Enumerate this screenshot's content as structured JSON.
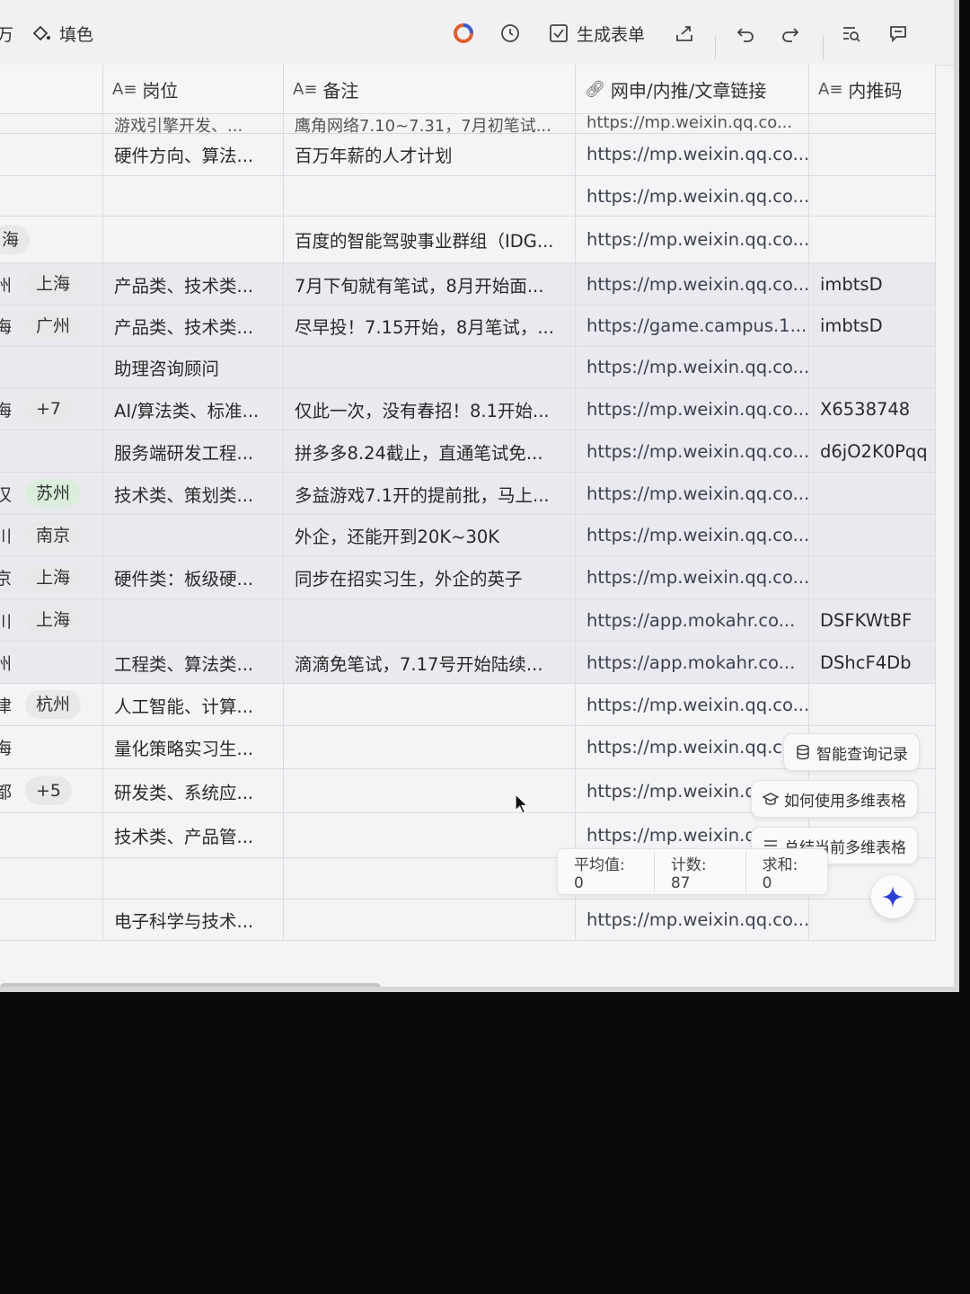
{
  "toolbar": {
    "fill_label": "填色",
    "form_label": "生成表单",
    "left_fragment": "万"
  },
  "columns": {
    "position": "岗位",
    "remark": "备注",
    "link": "网申/内推/文章链接",
    "code": "内推码"
  },
  "partial_row": {
    "position": "游戏引擎开发、...",
    "remark": "鹰角网络7.10~7.31，7月初笔试...",
    "link": "https://mp.weixin.qq.co..."
  },
  "rows": [
    {
      "frag": "",
      "tags": [],
      "position": "硬件方向、算法...",
      "remark": "百万年薪的人才计划",
      "link": "https://mp.weixin.qq.co...",
      "code": ""
    },
    {
      "frag": "",
      "tags": [],
      "position": "",
      "remark": "",
      "link": "https://mp.weixin.qq.co...",
      "code": ""
    },
    {
      "frag": "",
      "tags": [
        {
          "label": "海",
          "color": "plain"
        }
      ],
      "position": "",
      "remark": "百度的智能驾驶事业群组（IDG...",
      "link": "https://mp.weixin.qq.co...",
      "code": ""
    },
    {
      "frag": "州",
      "tags": [
        {
          "label": "上海",
          "color": "plain"
        }
      ],
      "position": "产品类、技术类...",
      "remark": "7月下旬就有笔试，8月开始面...",
      "link": "https://mp.weixin.qq.co...",
      "code": "imbtsD"
    },
    {
      "frag": "海",
      "tags": [
        {
          "label": "广州",
          "color": "plain"
        }
      ],
      "position": "产品类、技术类...",
      "remark": "尽早投！7.15开始，8月笔试，...",
      "link": "https://game.campus.1...",
      "code": "imbtsD"
    },
    {
      "frag": "",
      "tags": [],
      "position": "助理咨询顾问",
      "remark": "",
      "link": "https://mp.weixin.qq.co...",
      "code": ""
    },
    {
      "frag": "海",
      "tags": [
        {
          "label": "+7",
          "color": "plain"
        }
      ],
      "position": "AI/算法类、标准...",
      "remark": "仅此一次，没有春招！8.1开始...",
      "link": "https://mp.weixin.qq.co...",
      "code": "X6538748"
    },
    {
      "frag": "",
      "tags": [],
      "position": "服务端研发工程...",
      "remark": "拼多多8.24截止，直通笔试免...",
      "link": "https://mp.weixin.qq.co...",
      "code": "d6jO2K0Pqq"
    },
    {
      "frag": "汉",
      "tags": [
        {
          "label": "苏州",
          "color": "green"
        }
      ],
      "position": "技术类、策划类...",
      "remark": "多益游戏7.1开的提前批，马上...",
      "link": "https://mp.weixin.qq.co...",
      "code": ""
    },
    {
      "frag": "川",
      "tags": [
        {
          "label": "南京",
          "color": "plain"
        }
      ],
      "position": "",
      "remark": "外企，还能开到20K~30K",
      "link": "https://mp.weixin.qq.co...",
      "code": ""
    },
    {
      "frag": "京",
      "tags": [
        {
          "label": "上海",
          "color": "plain"
        }
      ],
      "position": "硬件类：板级硬...",
      "remark": "同步在招实习生，外企的英子",
      "link": "https://mp.weixin.qq.co...",
      "code": ""
    },
    {
      "frag": "川",
      "tags": [
        {
          "label": "上海",
          "color": "plain"
        }
      ],
      "position": "",
      "remark": "",
      "link": "https://app.mokahr.co...",
      "code": "DSFKWtBF"
    },
    {
      "frag": "州",
      "tags": [],
      "position": "工程类、算法类...",
      "remark": "滴滴免笔试，7.17号开始陆续...",
      "link": "https://app.mokahr.co...",
      "code": "DShcF4Db"
    },
    {
      "frag": "津",
      "tags": [
        {
          "label": "杭州",
          "color": "plain"
        }
      ],
      "position": "人工智能、计算...",
      "remark": "",
      "link": "https://mp.weixin.qq.co...",
      "code": ""
    },
    {
      "frag": "海",
      "tags": [],
      "position": "量化策略实习生...",
      "remark": "",
      "link": "https://mp.weixin.qq.co",
      "code": ""
    },
    {
      "frag": "都",
      "tags": [
        {
          "label": "+5",
          "color": "plain"
        }
      ],
      "position": "研发类、系统应...",
      "remark": "",
      "link": "https://mp.weixin.qc",
      "code": ""
    },
    {
      "frag": "",
      "tags": [],
      "position": "技术类、产品管...",
      "remark": "",
      "link": "https://mp.weixin.qq",
      "code": ""
    },
    {
      "frag": "",
      "tags": [],
      "position": "",
      "remark": "",
      "link": "",
      "code": ""
    },
    {
      "frag": "",
      "tags": [],
      "position": "电子科学与技术...",
      "remark": "",
      "link": "https://mp.weixin.qq.co...",
      "code": ""
    }
  ],
  "ai_panel": {
    "query_history": "智能查询记录",
    "how_to_use": "如何使用多维表格",
    "summarize": "总结当前多维表格"
  },
  "stats": {
    "average": "平均值: 0",
    "count": "计数: 87",
    "sum": "求和: 0"
  },
  "colors": {
    "accent": "#2b3fd6",
    "tag_green": "#dbeedd",
    "row_highlight": "#e9e9ef"
  }
}
